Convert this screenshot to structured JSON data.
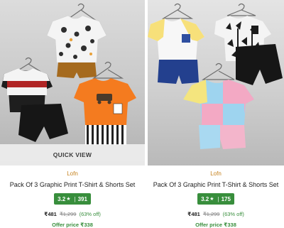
{
  "colors": {
    "brand": "#c47f19",
    "rating_bg": "#388e3c",
    "discount": "#388e3c",
    "mrp": "#878787"
  },
  "products": [
    {
      "quick_view": "QUICK VIEW",
      "brand": "Lofn",
      "title": "Pack Of 3 Graphic Print T-Shirt & Shorts Set",
      "rating": "3.2",
      "rating_icon": "star-icon",
      "rating_count": "391",
      "price": "₹481",
      "mrp": "₹1,299",
      "discount": "(63% off)",
      "offer_price": "Offer price ₹338"
    },
    {
      "brand": "Lofn",
      "title": "Pack Of 3 Graphic Print T-Shirt & Shorts Set",
      "rating": "3.2",
      "rating_icon": "star-icon",
      "rating_count": "175",
      "price": "₹481",
      "mrp": "₹1,299",
      "discount": "(63% off)",
      "offer_price": "Offer price ₹338"
    }
  ]
}
